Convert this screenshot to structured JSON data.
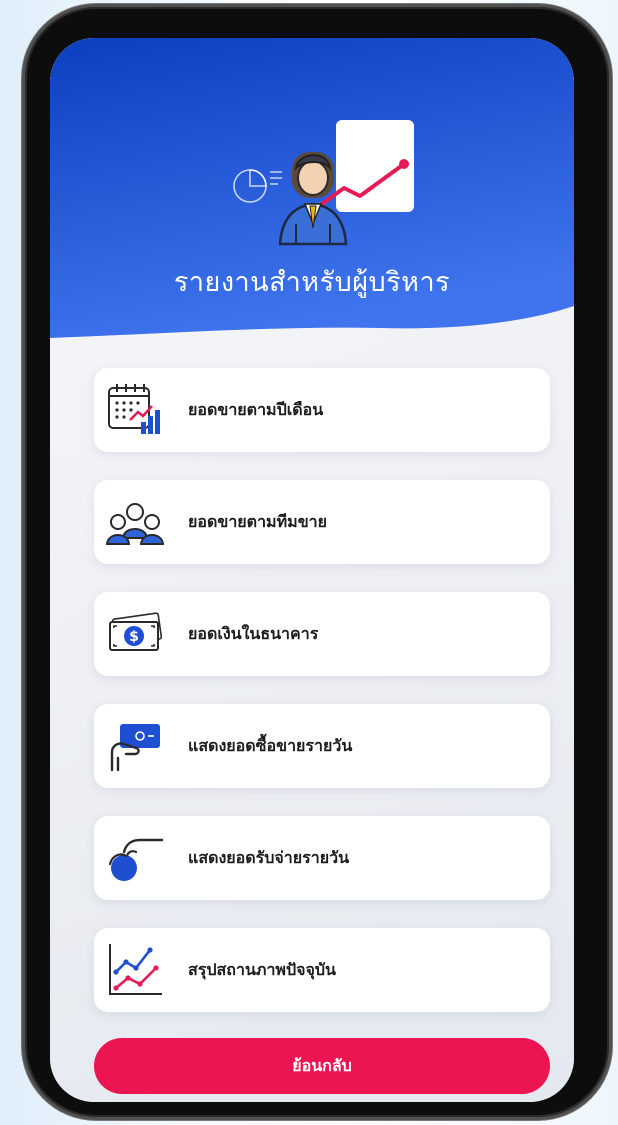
{
  "header": {
    "title": "รายงานสำหรับผู้บริหาร",
    "illustration_icon": "executive-report-icon",
    "colors": {
      "top": "#0c3fc0",
      "bottom": "#3f74ee"
    }
  },
  "menu": {
    "items": [
      {
        "label": "ยอดขายตามปีเดือน",
        "icon": "calendar-chart-icon"
      },
      {
        "label": "ยอดขายตามทีมขาย",
        "icon": "sales-team-icon"
      },
      {
        "label": "ยอดเงินในธนาคาร",
        "icon": "banknote-icon"
      },
      {
        "label": "แสดงยอดซื้อขายรายวัน",
        "icon": "hand-card-icon"
      },
      {
        "label": "แสดงยอดรับจ่ายรายวัน",
        "icon": "hand-coin-icon"
      },
      {
        "label": "สรุปสถานภาพปัจจุบัน",
        "icon": "trend-chart-icon"
      }
    ]
  },
  "footer": {
    "back_label": "ย้อนกลับ",
    "button_color": "#ec1451"
  }
}
